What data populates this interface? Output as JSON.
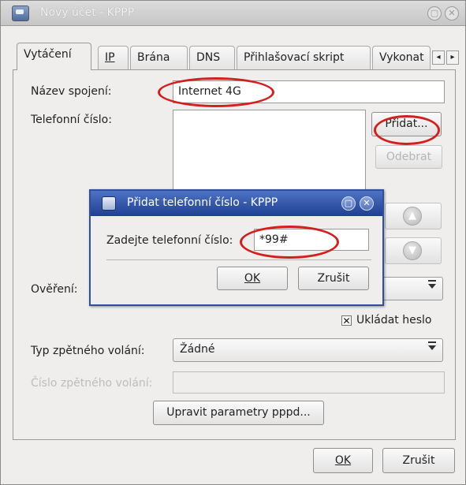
{
  "window": {
    "title": "Nový účet - KPPP"
  },
  "tabs": [
    {
      "label": "Vytáčení"
    },
    {
      "label": "IP"
    },
    {
      "label": "Brána"
    },
    {
      "label": "DNS"
    },
    {
      "label": "Přihlašovací skript"
    },
    {
      "label": "Vykonat"
    }
  ],
  "form": {
    "connection_name_label": "Název spojení:",
    "connection_name_value": "Internet 4G",
    "phone_label": "Telefonní číslo:",
    "add_button": "Přidat...",
    "remove_button": "Odebrat",
    "auth_label": "Ověření:",
    "save_password_label": "Ukládat heslo",
    "save_password_checked": true,
    "callback_type_label": "Typ zpětného volání:",
    "callback_type_value": "Žádné",
    "callback_number_label": "Číslo zpětného volání:",
    "callback_number_value": "",
    "pppd_button": "Upravit parametry pppd..."
  },
  "footer": {
    "ok": "OK",
    "cancel": "Zrušit"
  },
  "dialog": {
    "title": "Přidat telefonní číslo - KPPP",
    "prompt_label": "Zadejte telefonní číslo:",
    "phone_value": "*99#",
    "ok": "OK",
    "cancel": "Zrušit"
  },
  "colors": {
    "annotation_red": "#d41f1f",
    "dialog_title_blue": "#2f4f9e"
  }
}
